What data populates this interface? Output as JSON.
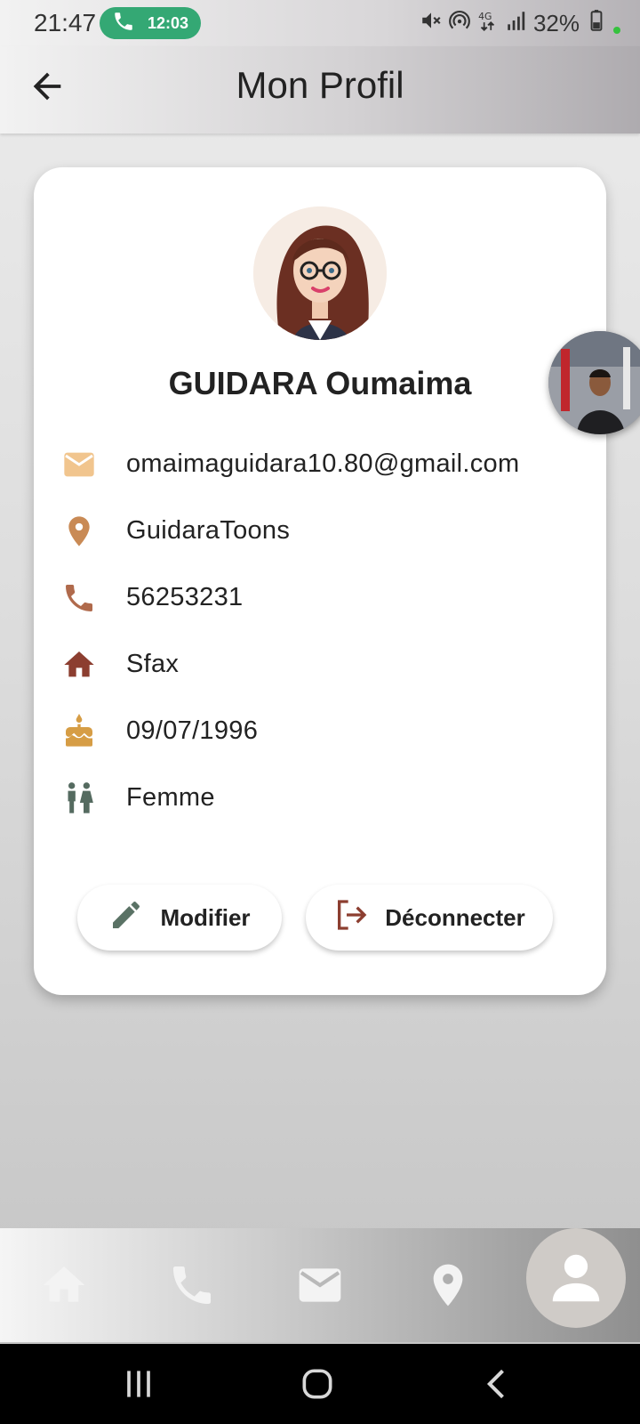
{
  "status_bar": {
    "time": "21:47",
    "call_duration": "12:03",
    "battery": "32%"
  },
  "header": {
    "title": "Mon Profil"
  },
  "profile": {
    "name": "GUIDARA Oumaima",
    "info": [
      {
        "icon": "email-icon",
        "value": "omaimaguidara10.80@gmail.com",
        "color": "#f1c58e"
      },
      {
        "icon": "location-pin-icon",
        "value": "GuidaraToons",
        "color": "#c98a55"
      },
      {
        "icon": "phone-icon",
        "value": "56253231",
        "color": "#b06a4c"
      },
      {
        "icon": "home-icon",
        "value": "Sfax",
        "color": "#8c3e30"
      },
      {
        "icon": "cake-icon",
        "value": "09/07/1996",
        "color": "#d69d45"
      },
      {
        "icon": "gender-icon",
        "value": "Femme",
        "color": "#556b60"
      }
    ]
  },
  "actions": {
    "edit_label": "Modifier",
    "logout_label": "Déconnecter"
  },
  "bottom_nav": {
    "items": [
      "home-icon",
      "phone-icon",
      "email-icon",
      "location-pin-icon",
      "person-icon"
    ],
    "active": "person-icon"
  },
  "colors": {
    "call_pill": "#34a874",
    "edit_icon": "#5a7265",
    "logout_icon": "#8c3e30"
  }
}
